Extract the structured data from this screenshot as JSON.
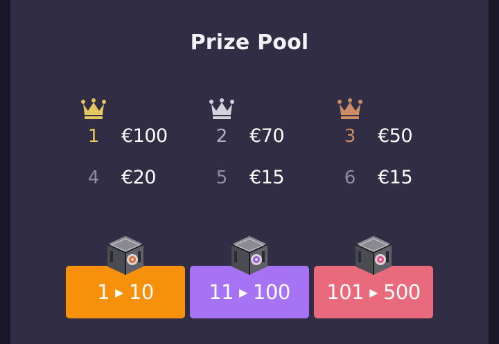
{
  "prize_pool": {
    "title": "Prize Pool",
    "colors": {
      "gold": "#e5c55d",
      "silver": "#d2d2dc",
      "bronze": "#cc8c64",
      "muted_rank": "#8f8ca3"
    },
    "prizes": [
      {
        "rank": "1",
        "amount": "€100",
        "crown": "gold-crown-icon"
      },
      {
        "rank": "2",
        "amount": "€70",
        "crown": "silver-crown-icon"
      },
      {
        "rank": "3",
        "amount": "€50",
        "crown": "bronze-crown-icon"
      },
      {
        "rank": "4",
        "amount": "€20"
      },
      {
        "rank": "5",
        "amount": "€15"
      },
      {
        "rank": "6",
        "amount": "€15"
      }
    ]
  },
  "tiers": [
    {
      "from": "1",
      "to": "10",
      "color": "#f7910b",
      "gem_color": "#e3673a",
      "icon": "case-cube-icon"
    },
    {
      "from": "11",
      "to": "100",
      "color": "#a673f5",
      "gem_color": "#9a5ae6",
      "icon": "case-cube-icon"
    },
    {
      "from": "101",
      "to": "500",
      "color": "#e86a7c",
      "gem_color": "#e64a8c",
      "icon": "case-cube-icon"
    }
  ]
}
